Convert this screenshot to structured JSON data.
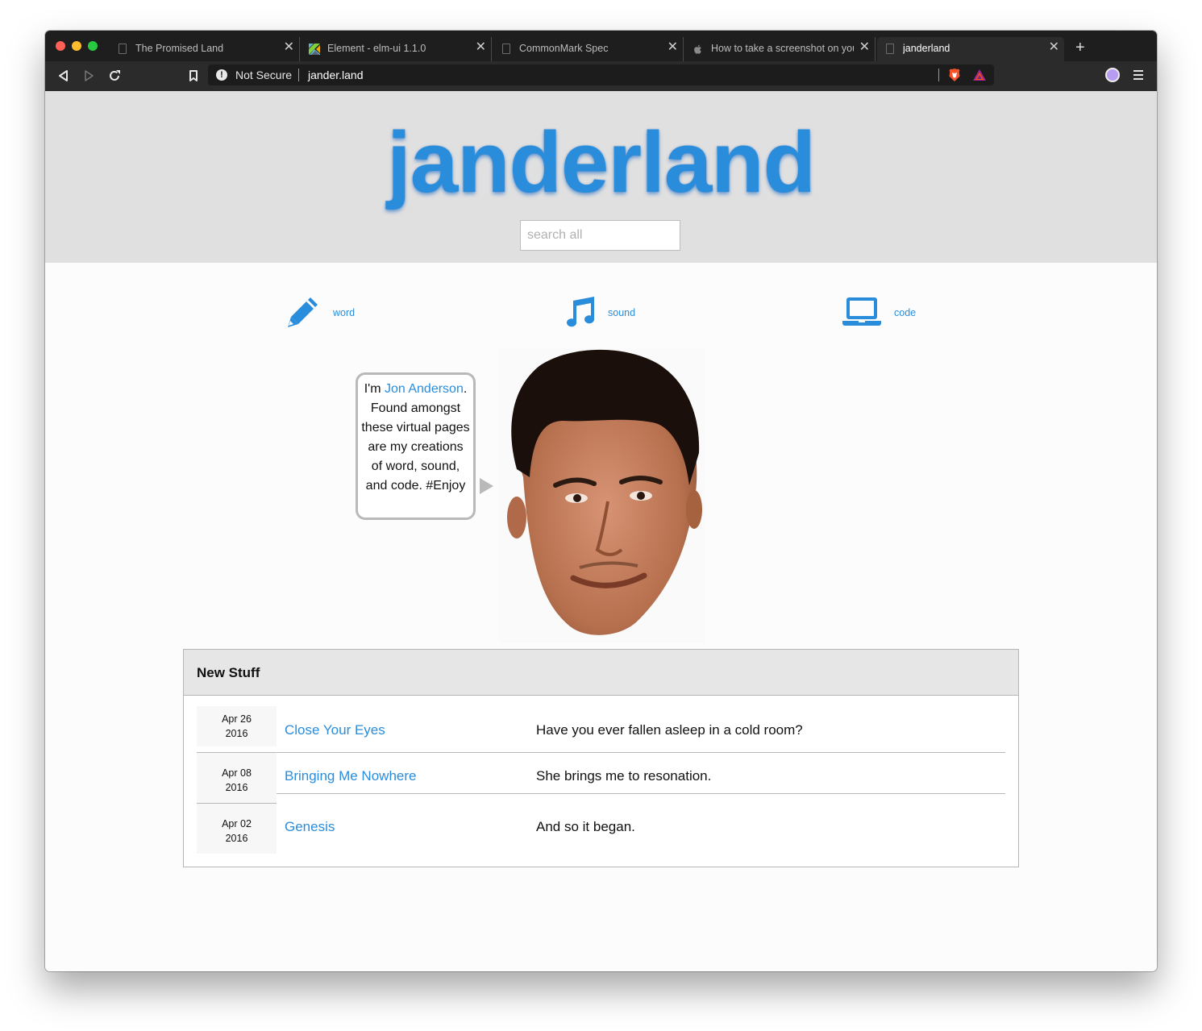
{
  "browser": {
    "tabs": [
      {
        "title": "The Promised Land",
        "favicon": "page-icon",
        "active": false
      },
      {
        "title": "Element - elm-ui 1.1.0",
        "favicon": "elm-logo-icon",
        "active": false
      },
      {
        "title": "CommonMark Spec",
        "favicon": "page-icon",
        "active": false
      },
      {
        "title": "How to take a screenshot on your Mac",
        "favicon": "apple-icon",
        "active": false
      },
      {
        "title": "janderland",
        "favicon": "page-icon",
        "active": true
      }
    ],
    "new_tab": "+",
    "close_glyph": "✕",
    "security_label": "Not Secure",
    "url": "jander.land"
  },
  "site": {
    "logo": "janderland",
    "search_placeholder": "search all",
    "nav": [
      {
        "label": "word",
        "icon": "pencil-icon"
      },
      {
        "label": "sound",
        "icon": "music-note-icon"
      },
      {
        "label": "code",
        "icon": "laptop-icon"
      }
    ],
    "bubble": {
      "prefix": "I'm ",
      "name": "Jon Anderson",
      "suffix": ". Found amongst these virtual pages are my creations of word, sound, and code. #Enjoy"
    },
    "portrait": "face-photo"
  },
  "new_stuff": {
    "title": "New Stuff",
    "rows": [
      {
        "date_md": "Apr 26",
        "date_y": "2016",
        "title": "Close Your Eyes",
        "desc": "Have you ever fallen asleep in a cold room?"
      },
      {
        "date_md": "Apr 08",
        "date_y": "2016",
        "title": "Bringing Me Nowhere",
        "desc": "She brings me to resonation."
      },
      {
        "date_md": "Apr 02",
        "date_y": "2016",
        "title": "Genesis",
        "desc": "And so it began."
      }
    ]
  },
  "colors": {
    "accent": "#2a8ddc",
    "hero_bg": "#e0e0e0",
    "chrome_dark": "#1e1e1e"
  }
}
